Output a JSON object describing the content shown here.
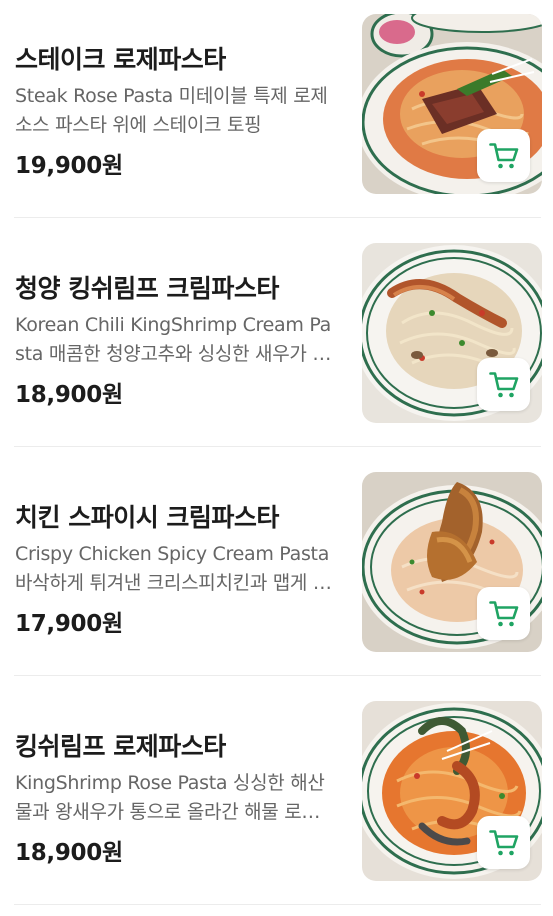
{
  "colors": {
    "accent": "#1fa463",
    "text_primary": "#1c1c1c",
    "text_secondary": "#666666",
    "divider": "#ececec"
  },
  "menu": {
    "items": [
      {
        "name": "스테이크 로제파스타",
        "description": "Steak Rose Pasta 미테이블 특제 로제소스 파스타 위에 스테이크 토핑",
        "price": "19,900원",
        "icon": "cart-icon"
      },
      {
        "name": "청양 킹쉬림프 크림파스타",
        "description": "Korean Chili KingShrimp Cream Pasta 매콤한 청양고추와 싱싱한 새우가 들어간 크림파스타",
        "price": "18,900원",
        "icon": "cart-icon"
      },
      {
        "name": "치킨 스파이시 크림파스타",
        "description": "Crispy Chicken Spicy Cream Pasta 바삭하게 튀겨낸 크리스피치킨과 맵게 즐기는 크림파스타",
        "price": "17,900원",
        "icon": "cart-icon"
      },
      {
        "name": "킹쉬림프 로제파스타",
        "description": "KingShrimp Rose Pasta 싱싱한 해산물과 왕새우가 통으로 올라간 해물 로제파스타",
        "price": "18,900원",
        "icon": "cart-icon"
      }
    ]
  }
}
